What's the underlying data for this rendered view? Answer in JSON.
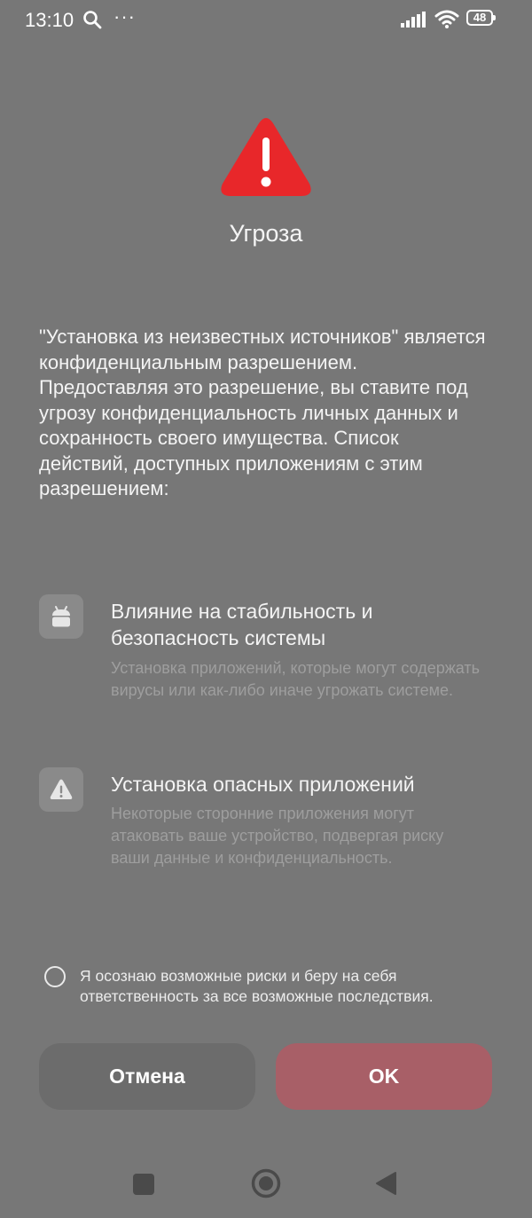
{
  "status_bar": {
    "time": "13:10",
    "more": "···",
    "battery": "48",
    "icons": [
      "search-icon",
      "signal-icon",
      "wifi-icon",
      "battery-icon"
    ]
  },
  "dialog": {
    "icon": "warning-triangle-icon",
    "icon_color": "#e8272a",
    "title": "Угроза",
    "description": "\"Установка из неизвестных источников\" является конфиденциальным разрешением. Предоставляя это разрешение, вы ставите под угрозу конфиденциальность личных данных и сохранность своего имущества. Список действий, доступных приложениям с этим разрешением:",
    "items": [
      {
        "icon": "android-icon",
        "title": "Влияние на стабильность и безопасность системы",
        "subtitle": "Установка приложений, которые могут содержать вирусы или как-либо иначе угрожать системе."
      },
      {
        "icon": "warning-icon",
        "title": "Установка опасных приложений",
        "subtitle": "Некоторые сторонние приложения могут атаковать ваше устройство, подвергая риску ваши данные и конфиденциальность."
      }
    ],
    "consent": {
      "checked": false,
      "text": "Я осознаю возможные риски и беру на себя ответственность за все возможные последствия."
    },
    "buttons": {
      "cancel": "Отмена",
      "ok": "OK",
      "ok_color": "#a85f67"
    }
  },
  "nav_bar": {
    "icons": [
      "recents-icon",
      "home-icon",
      "back-icon"
    ]
  }
}
